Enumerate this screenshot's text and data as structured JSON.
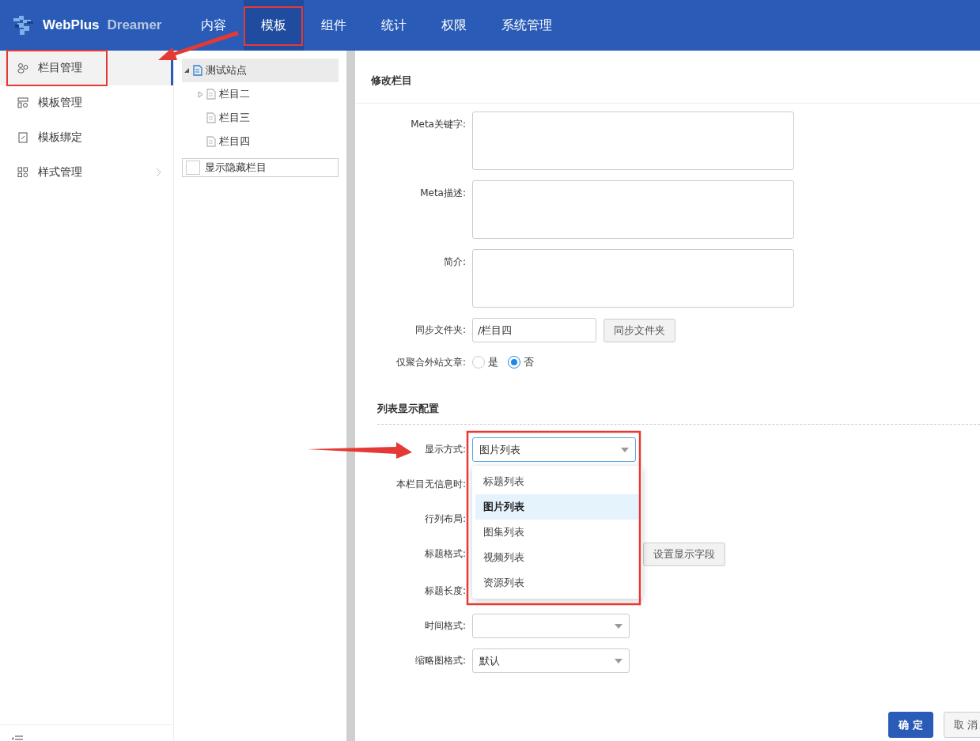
{
  "header": {
    "brand": "WebPlus",
    "brand_sub": "Dreamer",
    "nav": [
      {
        "label": "内容",
        "selected": false
      },
      {
        "label": "模板",
        "selected": true
      },
      {
        "label": "组件",
        "selected": false
      },
      {
        "label": "统计",
        "selected": false
      },
      {
        "label": "权限",
        "selected": false
      },
      {
        "label": "系统管理",
        "selected": false
      }
    ]
  },
  "sidebar": {
    "items": [
      {
        "label": "栏目管理",
        "selected": true,
        "has_children": false
      },
      {
        "label": "模板管理",
        "selected": false,
        "has_children": false
      },
      {
        "label": "模板绑定",
        "selected": false,
        "has_children": false
      },
      {
        "label": "样式管理",
        "selected": false,
        "has_children": true
      }
    ]
  },
  "tree": {
    "label": "测试站点",
    "selected": true,
    "expanded": true,
    "children": [
      {
        "label": "栏目二",
        "selected": false,
        "expandable": true
      },
      {
        "label": "栏目三",
        "selected": false,
        "expandable": false
      },
      {
        "label": "栏目四",
        "selected": false,
        "expandable": false
      }
    ]
  },
  "show_hidden": {
    "label": "显示隐藏栏目",
    "checked": false
  },
  "form": {
    "title": "修改栏目",
    "textareas": [
      {
        "label": "Meta关键字:"
      },
      {
        "label": "Meta描述:"
      },
      {
        "label": "简介:"
      }
    ],
    "folder": {
      "label": "同步文件夹:",
      "value": "/栏目四",
      "button": "同步文件夹"
    },
    "external": {
      "label": "仅聚合外站文章:",
      "options": [
        {
          "label": "是",
          "selected": false
        },
        {
          "label": "否",
          "selected": true
        }
      ]
    },
    "section": "列表显示配置",
    "display_mode": {
      "label": "显示方式:",
      "value": "图片列表",
      "expanded": true,
      "options": [
        {
          "label": "标题列表",
          "selected": false
        },
        {
          "label": "图片列表",
          "selected": true
        },
        {
          "label": "图集列表",
          "selected": false
        },
        {
          "label": "视频列表",
          "selected": false
        },
        {
          "label": "资源列表",
          "selected": false
        }
      ]
    },
    "hidden_rows": [
      {
        "label": "本栏目无信息时:"
      },
      {
        "label": "行列布局:"
      },
      {
        "label": "标题格式:",
        "button": "设置显示字段"
      },
      {
        "label": "标题长度:"
      }
    ],
    "time_format": {
      "label": "时间格式:"
    },
    "thumb_format": {
      "label": "缩略图格式:",
      "value": "默认"
    },
    "buttons": [
      {
        "label": "确 定",
        "kind": "primary"
      },
      {
        "label": "取 消",
        "kind": "default"
      }
    ]
  }
}
